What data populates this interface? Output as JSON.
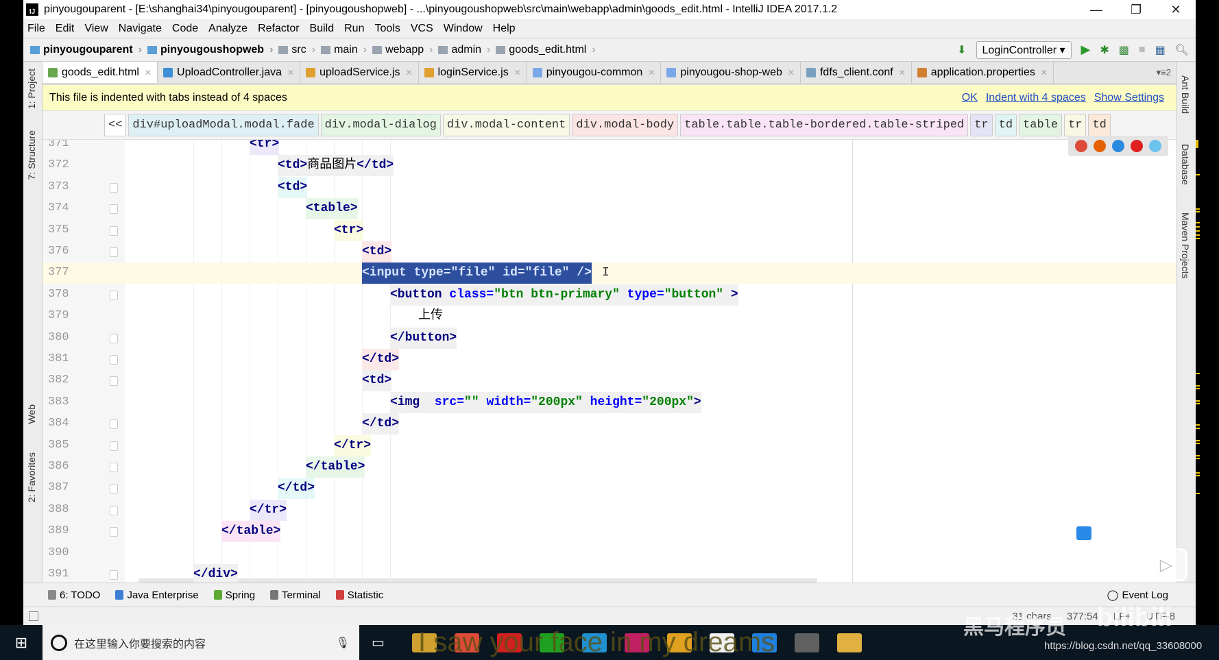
{
  "window": {
    "title": "pinyougouparent - [E:\\shanghai34\\pinyougouparent] - [pinyougoushopweb] - ...\\pinyougoushopweb\\src\\main\\webapp\\admin\\goods_edit.html - IntelliJ IDEA 2017.1.2",
    "logo": "IJ",
    "minimize": "—",
    "restore": "❐",
    "close": "✕"
  },
  "menu": [
    "File",
    "Edit",
    "View",
    "Navigate",
    "Code",
    "Analyze",
    "Refactor",
    "Build",
    "Run",
    "Tools",
    "VCS",
    "Window",
    "Help"
  ],
  "nav": {
    "crumbs": [
      {
        "label": "pinyougouparent",
        "bold": true
      },
      {
        "label": "pinyougoushopweb",
        "bold": true
      },
      {
        "label": "src"
      },
      {
        "label": "main"
      },
      {
        "label": "webapp"
      },
      {
        "label": "admin"
      },
      {
        "label": "goods_edit.html"
      }
    ],
    "run_config": "LoginController ▾",
    "icons": [
      "sort-icon",
      "run-icon",
      "debug-icon",
      "coverage-icon",
      "stop-icon",
      "project-structure-icon",
      "search-icon"
    ]
  },
  "tabs": [
    {
      "label": "goods_edit.html",
      "color": "#6aa84f",
      "active": true
    },
    {
      "label": "UploadController.java",
      "color": "#3d8fd6"
    },
    {
      "label": "uploadService.js",
      "color": "#e0a030"
    },
    {
      "label": "loginService.js",
      "color": "#e0a030"
    },
    {
      "label": "pinyougou-common",
      "color": "#7aa7e8"
    },
    {
      "label": "pinyougou-shop-web",
      "color": "#7aa7e8"
    },
    {
      "label": "fdfs_client.conf",
      "color": "#7aa0c0"
    },
    {
      "label": "application.properties",
      "color": "#d08030"
    }
  ],
  "tabs_overflow": "▾≡2",
  "notice": {
    "text": "This file is indented with tabs instead of 4 spaces",
    "ok": "OK",
    "indent": "Indent with 4 spaces",
    "settings": "Show Settings"
  },
  "breadcrumb": {
    "back": "<<",
    "items": [
      {
        "label": "div#uploadModal.modal.fade",
        "color": "#dff0f5"
      },
      {
        "label": "div.modal-dialog",
        "color": "#e4f5e4"
      },
      {
        "label": "div.modal-content",
        "color": "#f8f8e6"
      },
      {
        "label": "div.modal-body",
        "color": "#fbe4e4"
      },
      {
        "label": "table.table.table-bordered.table-striped",
        "color": "#f8e4f4"
      },
      {
        "label": "tr",
        "color": "#e4e4f6"
      },
      {
        "label": "td",
        "color": "#e0f4f4"
      },
      {
        "label": "table",
        "color": "#e4f4e4"
      },
      {
        "label": "tr",
        "color": "#f8f8e4"
      },
      {
        "label": "td",
        "color": "#fbe8d8"
      }
    ]
  },
  "code": [
    {
      "n": "371",
      "indent": 3,
      "bg": "#ece8fa",
      "tokens": [
        [
          "tg",
          "<tr>"
        ]
      ]
    },
    {
      "n": "372",
      "indent": 4,
      "bg": "#f0f0f0",
      "tokens": [
        [
          "tg",
          "<td>"
        ],
        [
          "tx",
          "商品图片"
        ],
        [
          "tg",
          "</td>"
        ]
      ]
    },
    {
      "n": "373",
      "indent": 4,
      "bg": "#e6f7f7",
      "fold": true,
      "tokens": [
        [
          "tg",
          "<td>"
        ]
      ]
    },
    {
      "n": "374",
      "indent": 5,
      "bg": "#e8f6e8",
      "fold": true,
      "tokens": [
        [
          "tg",
          "<table>"
        ]
      ]
    },
    {
      "n": "375",
      "indent": 6,
      "bg": "#fafae0",
      "fold": true,
      "tokens": [
        [
          "tg",
          "<tr>"
        ]
      ]
    },
    {
      "n": "376",
      "indent": 7,
      "bg": "#fde8e8",
      "fold": true,
      "tokens": [
        [
          "tg",
          "<td>"
        ]
      ]
    },
    {
      "n": "377",
      "indent": 7,
      "current": true,
      "selected": true,
      "tokens": [
        [
          "tg",
          "<input "
        ],
        [
          "at",
          "type="
        ],
        [
          "vl",
          "\"file\" "
        ],
        [
          "at",
          "id="
        ],
        [
          "vl",
          "\"file\" "
        ],
        [
          "tg",
          "/>"
        ]
      ]
    },
    {
      "n": "378",
      "indent": 8,
      "bg": "#f0f0f0",
      "fold": true,
      "tokens": [
        [
          "tg",
          "<button "
        ],
        [
          "at",
          "class="
        ],
        [
          "vl",
          "\"btn btn-primary\" "
        ],
        [
          "at",
          "type="
        ],
        [
          "vl",
          "\"button\" "
        ],
        [
          "tg",
          ">"
        ]
      ]
    },
    {
      "n": "379",
      "indent": 9,
      "tokens": [
        [
          "tx",
          "上传"
        ]
      ]
    },
    {
      "n": "380",
      "indent": 8,
      "bg": "#f0f0f0",
      "fold": true,
      "tokens": [
        [
          "tg",
          "</button>"
        ]
      ]
    },
    {
      "n": "381",
      "indent": 7,
      "bg": "#fde8e8",
      "fold": true,
      "tokens": [
        [
          "tg",
          "</td>"
        ]
      ]
    },
    {
      "n": "382",
      "indent": 7,
      "bg": "#f0f0f0",
      "fold": true,
      "tokens": [
        [
          "tg",
          "<td>"
        ]
      ]
    },
    {
      "n": "383",
      "indent": 8,
      "bg": "#f0f0f0",
      "tokens": [
        [
          "tg",
          "<img  "
        ],
        [
          "at",
          "src="
        ],
        [
          "vl",
          "\"\" "
        ],
        [
          "at",
          "width="
        ],
        [
          "vl",
          "\"200px\" "
        ],
        [
          "at",
          "height="
        ],
        [
          "vl",
          "\"200px\""
        ],
        [
          "tg",
          ">"
        ]
      ]
    },
    {
      "n": "384",
      "indent": 7,
      "bg": "#f0f0f0",
      "fold": true,
      "tokens": [
        [
          "tg",
          "</td>"
        ]
      ]
    },
    {
      "n": "385",
      "indent": 6,
      "bg": "#fafae0",
      "fold": true,
      "tokens": [
        [
          "tg",
          "</tr>"
        ]
      ]
    },
    {
      "n": "386",
      "indent": 5,
      "bg": "#e8f6e8",
      "fold": true,
      "tokens": [
        [
          "tg",
          "</table>"
        ]
      ]
    },
    {
      "n": "387",
      "indent": 4,
      "bg": "#e6f7f7",
      "fold": true,
      "tokens": [
        [
          "tg",
          "</td>"
        ]
      ]
    },
    {
      "n": "388",
      "indent": 3,
      "bg": "#ece8fa",
      "fold": true,
      "tokens": [
        [
          "tg",
          "</tr>"
        ]
      ]
    },
    {
      "n": "389",
      "indent": 2,
      "bg": "#fce4f4",
      "fold": true,
      "tokens": [
        [
          "tg",
          "</table>"
        ]
      ]
    },
    {
      "n": "390",
      "indent": 1,
      "tokens": []
    },
    {
      "n": "391",
      "indent": 1,
      "bg": "#f0f0f0",
      "fold": true,
      "tokens": [
        [
          "tg",
          "</div>"
        ]
      ]
    }
  ],
  "left_tools": [
    "1: Project",
    "7: Structure",
    "Web",
    "2: Favorites"
  ],
  "right_tools": [
    "Ant Build",
    "Database",
    "Maven Projects"
  ],
  "browsers": [
    {
      "name": "chrome-icon",
      "color": "#dd4b39"
    },
    {
      "name": "firefox-icon",
      "color": "#e66000"
    },
    {
      "name": "safari-icon",
      "color": "#2a8ae0"
    },
    {
      "name": "opera-icon",
      "color": "#e02020"
    },
    {
      "name": "ie-icon",
      "color": "#6cc4ee"
    }
  ],
  "bottom_tools": [
    {
      "label": "6: TODO",
      "color": "#888"
    },
    {
      "label": "Java Enterprise",
      "color": "#3d7fd6"
    },
    {
      "label": "Spring",
      "color": "#5ca830"
    },
    {
      "label": "Terminal",
      "color": "#777"
    },
    {
      "label": "Statistic",
      "color": "#d04040"
    }
  ],
  "event_log": "Event Log",
  "status": {
    "chars": "31 chars",
    "pos": "377:54",
    "lf": "LF÷",
    "enc": "UTF-8"
  },
  "taskbar": {
    "search_placeholder": "在这里输入你要搜索的内容",
    "apps": [
      "#d0a030",
      "#dd4b39",
      "#d02020",
      "#20a020",
      "#2090d0",
      "#c02060",
      "#e0a020",
      "#f0f0f0",
      "#2080e0",
      "#606060",
      "#e0b040"
    ]
  },
  "overlay": {
    "subtitle": "I saw your face in my dreams",
    "url": "https://blog.csdn.net/qq_33608000",
    "brand": "黑马程序员",
    "bili": "bilibili"
  }
}
